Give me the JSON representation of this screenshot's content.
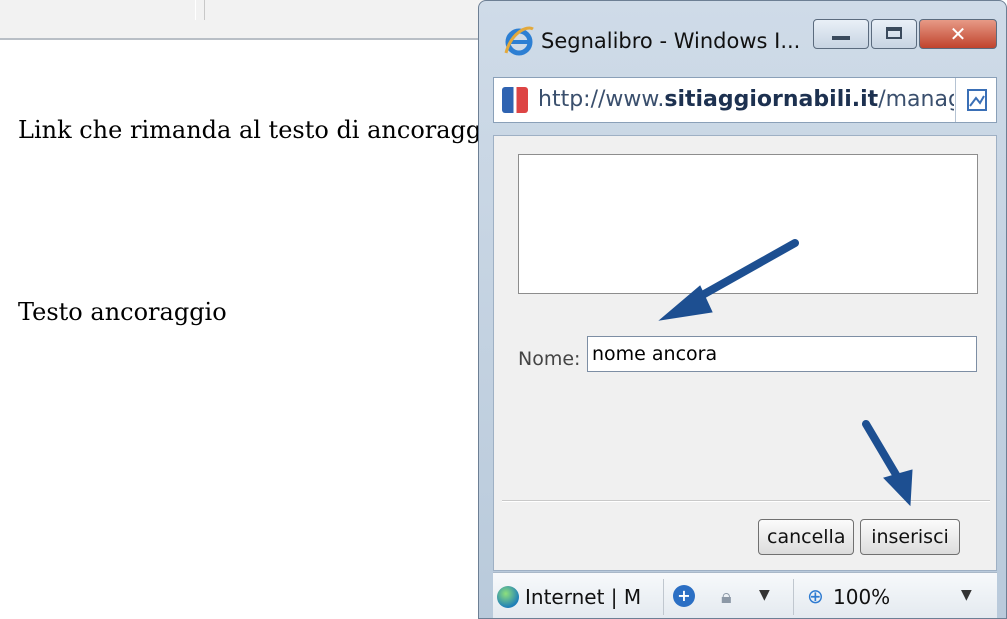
{
  "page": {
    "line_1": "Link che rimanda al testo di ancoraggio",
    "line_2": "Testo ancoraggio"
  },
  "window": {
    "title": "Segnalibro - Windows I...",
    "address_prefix": "http://www.",
    "address_domain": "sitiaggiornabili.it",
    "address_suffix": "/manag",
    "controls": {
      "close": "✕"
    }
  },
  "form": {
    "nome_label": "Nome:",
    "nome_value": "nome ancora",
    "cancel_label": "cancella",
    "insert_label": "inserisci"
  },
  "statusbar": {
    "zone_text": "Internet | M",
    "zoom_text": "100%",
    "addon_glyph": "+"
  },
  "icons": [
    "ie-icon",
    "page-icon",
    "compat-view-icon",
    "globe-icon",
    "addon-icon",
    "lock-icon",
    "zoom-icon",
    "dropdown-arrow-icon"
  ],
  "colors": {
    "arrow": "#1d4f91",
    "close_button": "#c0432d",
    "window_frame": "#b9cadb"
  }
}
